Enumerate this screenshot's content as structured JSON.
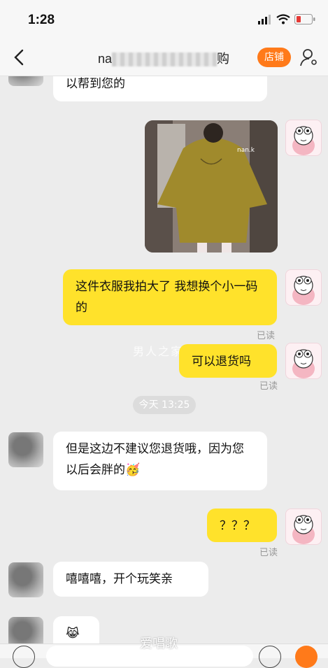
{
  "status_bar": {
    "time": "1:28"
  },
  "header": {
    "title_prefix": "na",
    "title_suffix": "购",
    "shop_button": "店铺"
  },
  "messages": {
    "m1": "以帮到您的",
    "m2": "这件衣服我拍大了 我想换个小一码的",
    "m2_read": "已读",
    "m3": "可以退货吗",
    "m3_read": "已读",
    "time_divider": "今天 13:25",
    "m4": "但是这边不建议您退货哦，因为您以后会胖的🥳",
    "m5": "？？？",
    "m5_read": "已读",
    "m6": "嘻嘻嘻，开个玩笑亲",
    "m7": "😹"
  },
  "photo": {
    "watermark_text": "nan.k"
  },
  "watermarks": {
    "center": "男人之家",
    "bottom": "爱唱歌"
  },
  "colors": {
    "bubble_right": "#ffe22b",
    "shop_button": "#ff7a1a",
    "background": "#ececec"
  }
}
